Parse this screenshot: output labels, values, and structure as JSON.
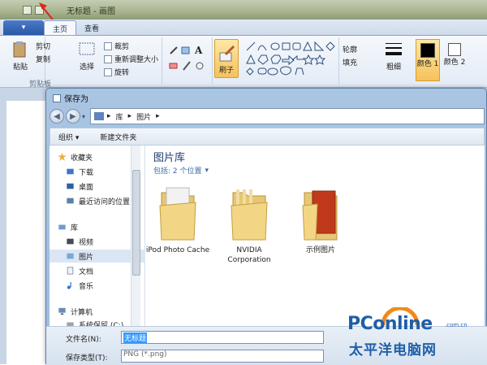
{
  "titlebar": {
    "title": "无标题 - 画图"
  },
  "ribbon": {
    "app_menu_label": "▾",
    "tabs": [
      {
        "label": "主页",
        "active": true
      },
      {
        "label": "查看",
        "active": false
      }
    ],
    "paste_label": "粘贴",
    "cut_label": "剪切",
    "copy_label": "复制",
    "clipboard_group": "剪贴板",
    "select_label": "选择",
    "crop_label": "裁剪",
    "resize_label": "重新调整大小",
    "rotate_label": "旋转",
    "brush_label": "刷子",
    "outline_label": "轮廓",
    "fill_label": "填充",
    "size_label": "粗细",
    "color1_label": "颜色 1",
    "color2_label": "颜色 2"
  },
  "dialog": {
    "title": "保存为",
    "breadcrumb": [
      "库",
      "图片"
    ],
    "commands": {
      "organize": "组织 ▾",
      "new_folder": "新建文件夹"
    },
    "nav": {
      "favorites": "收藏夹",
      "downloads": "下载",
      "desktop": "桌面",
      "recent": "最近访问的位置",
      "libraries": "库",
      "videos": "视频",
      "pictures": "图片",
      "documents": "文档",
      "music": "音乐",
      "computer": "计算机",
      "drive_c": "系统保留 (C:)"
    },
    "library": {
      "title": "图片库",
      "subtitle": "包括: 2 个位置",
      "subtitle_arrow": "▾"
    },
    "folders": [
      {
        "name": "iPod Photo Cache"
      },
      {
        "name": "NVIDIA Corporation"
      },
      {
        "name": "示例图片"
      }
    ],
    "filename_label": "文件名(N):",
    "filename_value": "无标题",
    "filetype_label": "保存类型(T):",
    "filetype_value": "PNG (*.png)"
  },
  "logo": {
    "brand_pc": "PC",
    "brand_online": "online",
    "domain": ".com.cn",
    "chinese": "太平洋电脑网"
  },
  "colors": {
    "accent": "#1f5fa8",
    "selection": "#3399ff",
    "dialog_chrome": "#a9c5e2"
  }
}
